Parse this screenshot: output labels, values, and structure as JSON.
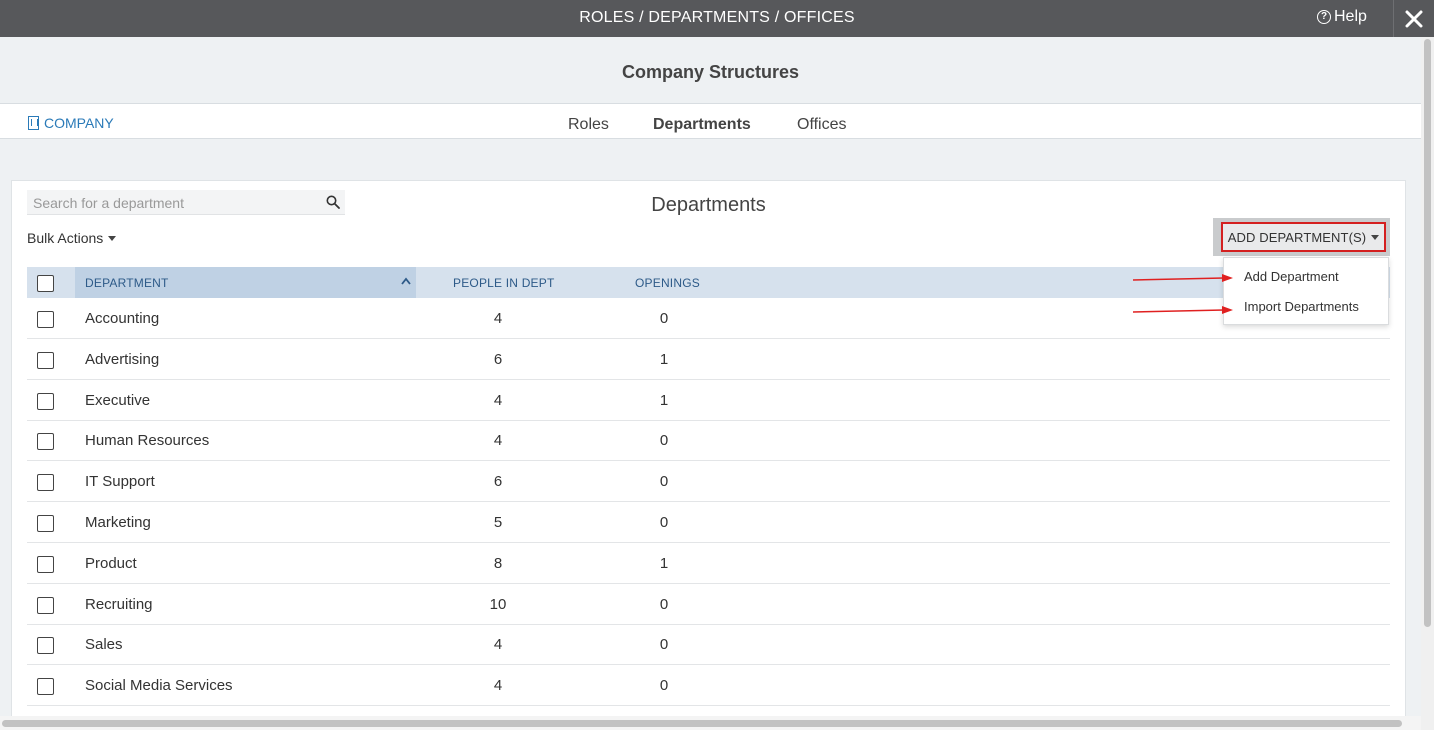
{
  "window": {
    "title": "ROLES / DEPARTMENTS / OFFICES",
    "help_label": "Help"
  },
  "header": {
    "title": "Company Structures"
  },
  "nav": {
    "company_label": "COMPANY",
    "tabs": [
      {
        "label": "Roles",
        "active": false
      },
      {
        "label": "Departments",
        "active": true
      },
      {
        "label": "Offices",
        "active": false
      }
    ]
  },
  "panel": {
    "title": "Departments",
    "search_placeholder": "Search for a department",
    "bulk_actions_label": "Bulk Actions",
    "add_button_label": "ADD DEPARTMENT(S)",
    "dropdown_items": [
      "Add Department",
      "Import Departments"
    ]
  },
  "table": {
    "columns": [
      "DEPARTMENT",
      "PEOPLE IN DEPT",
      "OPENINGS"
    ],
    "rows": [
      {
        "name": "Accounting",
        "people": "4",
        "openings": "0"
      },
      {
        "name": "Advertising",
        "people": "6",
        "openings": "1"
      },
      {
        "name": "Executive",
        "people": "4",
        "openings": "1"
      },
      {
        "name": "Human Resources",
        "people": "4",
        "openings": "0"
      },
      {
        "name": "IT Support",
        "people": "6",
        "openings": "0"
      },
      {
        "name": "Marketing",
        "people": "5",
        "openings": "0"
      },
      {
        "name": "Product",
        "people": "8",
        "openings": "1"
      },
      {
        "name": "Recruiting",
        "people": "10",
        "openings": "0"
      },
      {
        "name": "Sales",
        "people": "4",
        "openings": "0"
      },
      {
        "name": "Social Media Services",
        "people": "4",
        "openings": "0"
      }
    ]
  },
  "colors": {
    "topbar": "#57585b",
    "accent_link": "#2a7ab8",
    "header_row": "#d6e1ed",
    "highlight_border": "#d42020"
  }
}
